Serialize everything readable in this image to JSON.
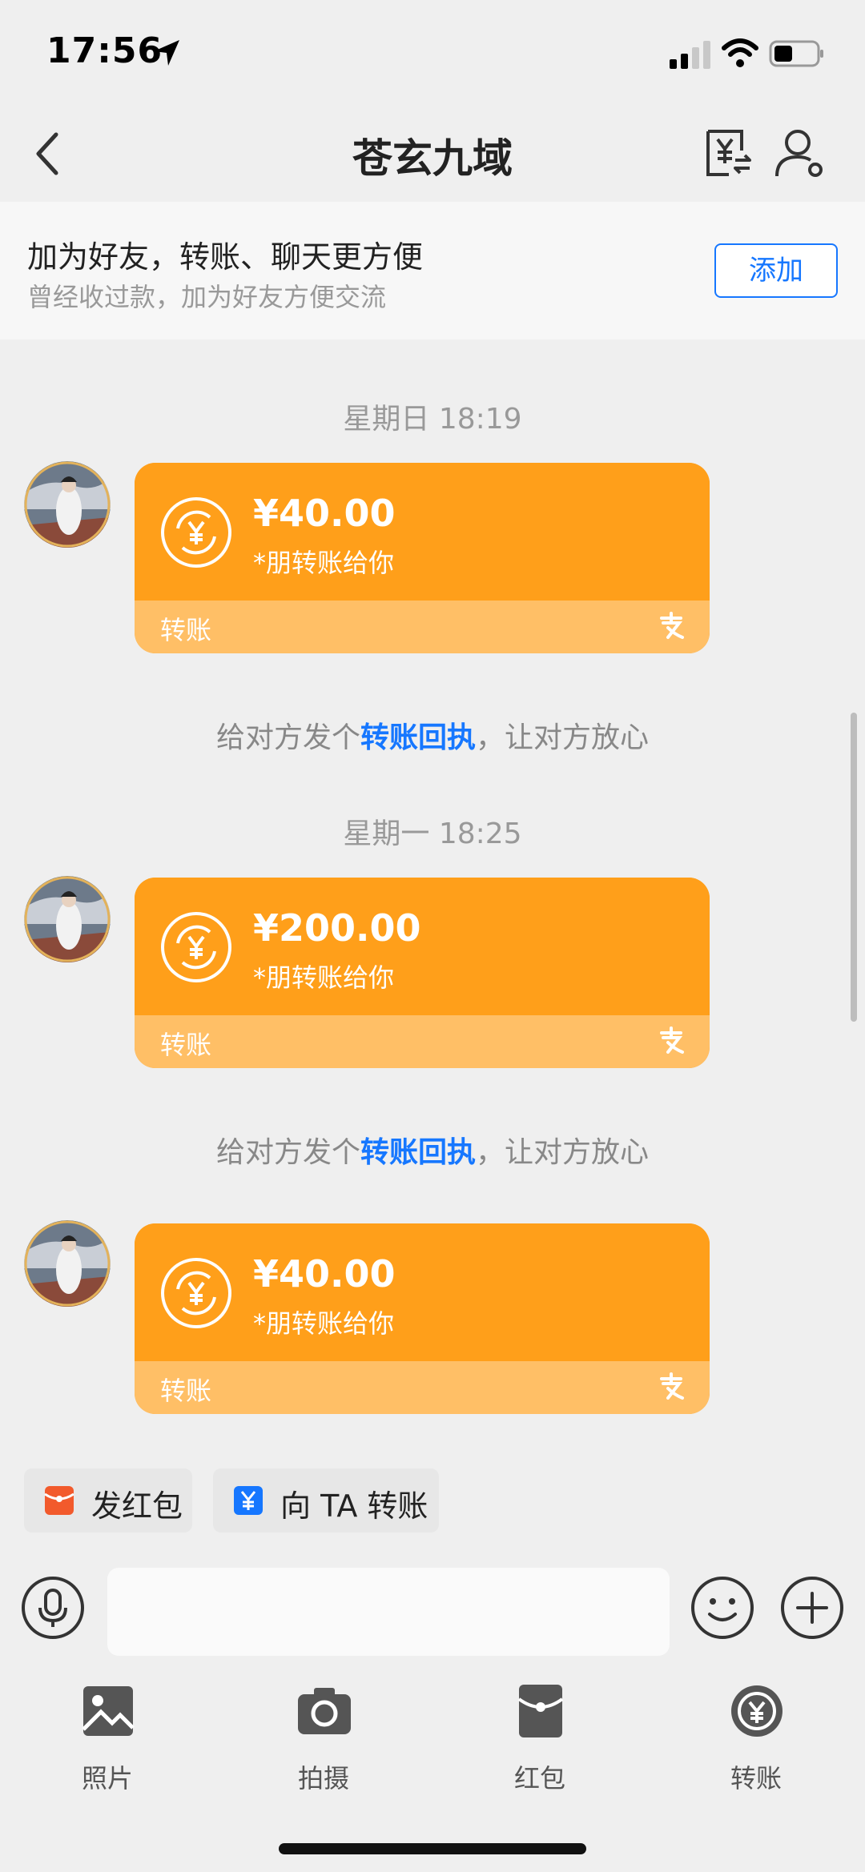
{
  "status_bar": {
    "time": "17:56",
    "icons": [
      "location-arrow-icon",
      "signal-icon",
      "wifi-icon",
      "battery-icon"
    ]
  },
  "nav": {
    "title": "苍玄九域",
    "icons": [
      "back-icon",
      "bill-transfer-icon",
      "profile-settings-icon"
    ]
  },
  "friend_banner": {
    "title": "加为好友，转账、聊天更方便",
    "subtitle": "曾经收过款，加为好友方便交流",
    "add_label": "添加"
  },
  "messages": [
    {
      "timestamp": "星期日 18:19",
      "amount": "¥40.00",
      "description": "*朋转账给你",
      "card_type": "转账",
      "notice_prefix": "给对方发个",
      "notice_link": "转账回执",
      "notice_suffix": "，让对方放心"
    },
    {
      "timestamp": "星期一 18:25",
      "amount": "¥200.00",
      "description": "*朋转账给你",
      "card_type": "转账",
      "notice_prefix": "给对方发个",
      "notice_link": "转账回执",
      "notice_suffix": "，让对方放心"
    },
    {
      "amount": "¥40.00",
      "description": "*朋转账给你",
      "card_type": "转账"
    }
  ],
  "quick_actions": [
    {
      "label": "发红包",
      "icon": "red-envelope-icon",
      "color": "#f25a2c"
    },
    {
      "label": "向 TA 转账",
      "icon": "transfer-yuan-icon",
      "color": "#1677ff"
    }
  ],
  "input": {
    "placeholder": ""
  },
  "tools": [
    {
      "label": "照片",
      "icon": "photo-icon"
    },
    {
      "label": "拍摄",
      "icon": "camera-icon"
    },
    {
      "label": "红包",
      "icon": "red-envelope-icon"
    },
    {
      "label": "转账",
      "icon": "transfer-icon"
    }
  ],
  "colors": {
    "card_orange": "#ff9f1a",
    "card_footer": "#ffbf66",
    "link_blue": "#1677ff",
    "background": "#efefef"
  }
}
